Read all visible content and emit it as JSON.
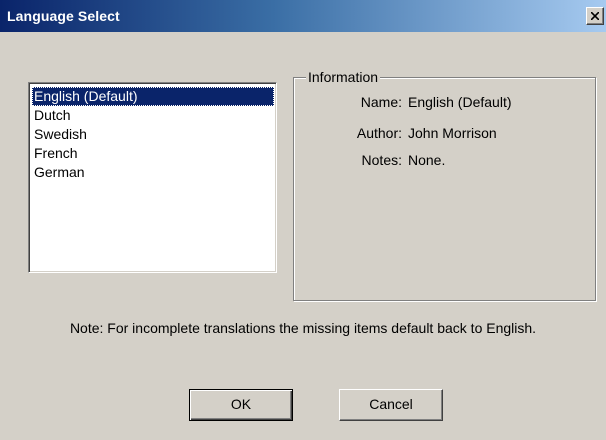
{
  "window": {
    "title": "Language Select",
    "close_icon": "close-icon"
  },
  "languages": {
    "items": [
      "English (Default)",
      "Dutch",
      "Swedish",
      "French",
      "German"
    ],
    "selected": "English (Default)"
  },
  "information": {
    "legend": "Information",
    "name_label": "Name:",
    "name_value": "English (Default)",
    "author_label": "Author:",
    "author_value": "John Morrison",
    "notes_label": "Notes:",
    "notes_value": "None."
  },
  "note": "Note: For incomplete translations the missing items default back to English.",
  "buttons": {
    "ok_label": "OK",
    "cancel_label": "Cancel"
  },
  "colors": {
    "title_bar": "#0a246a",
    "selection": "#0a246a",
    "window_face": "#d4d0c8"
  }
}
